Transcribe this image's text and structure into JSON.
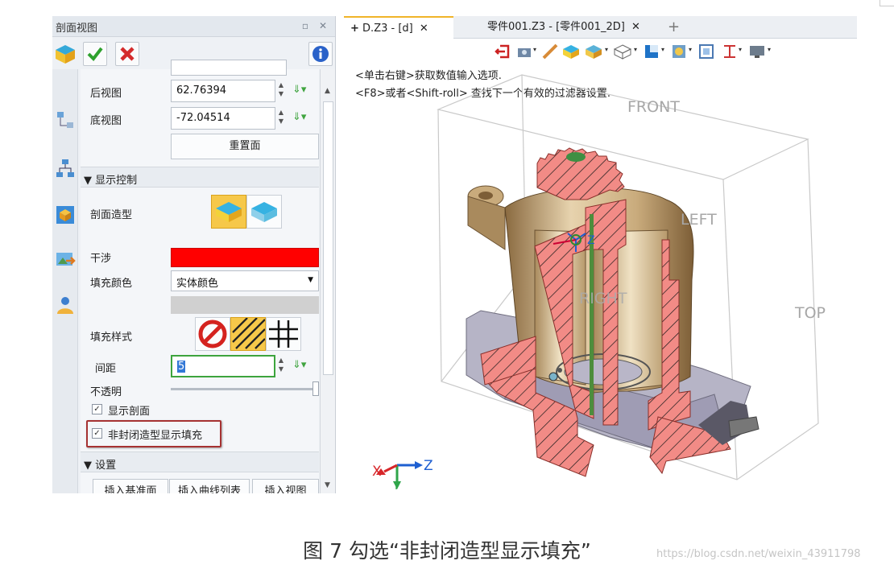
{
  "panel": {
    "title": "剖面视图",
    "pin_icon": "pin-icon",
    "close_icon": "close-icon",
    "view_rows": [
      {
        "label": "后视图",
        "value": "62.76394"
      },
      {
        "label": "底视图",
        "value": "-72.04514"
      }
    ],
    "reset_button": "重置面",
    "display_section": {
      "header": "显示控制",
      "section_shape_label": "剖面造型",
      "interference_label": "干涉",
      "interference_color": "#ff0000",
      "fill_color_label": "填充颜色",
      "fill_color_value": "实体颜色",
      "fill_style_label": "填充样式",
      "spacing_label": "间距",
      "spacing_value": "5",
      "opacity_label": "不透明",
      "opacity_level": 1.0,
      "show_section_label": "显示剖面",
      "non_closed_fill_label": "非封闭造型显示填充"
    },
    "settings_section": {
      "header": "设置",
      "buttons": [
        "插入基准面",
        "插入曲线列表",
        "插入视图"
      ]
    }
  },
  "tabs": [
    {
      "label": "D.Z3 - [d]",
      "active": true
    },
    {
      "label": "零件001.Z3 - [零件001_2D]",
      "active": false
    }
  ],
  "viewport": {
    "hint1": "<单击右键>获取数值输入选项.",
    "hint2": "<F8>或者<Shift-roll> 查找下一个有效的过滤器设置.",
    "labels": {
      "front": "FRONT",
      "left": "LEFT",
      "right": "RIGHT",
      "top": "TOP"
    },
    "axes": {
      "x": "X",
      "y": "Y",
      "z": "Z"
    },
    "section_color": "#f28b86",
    "body_color": "#c9ab7c"
  },
  "caption": "图 7 勾选“非封闭造型显示填充”",
  "watermark": "https://blog.csdn.net/weixin_43911798"
}
